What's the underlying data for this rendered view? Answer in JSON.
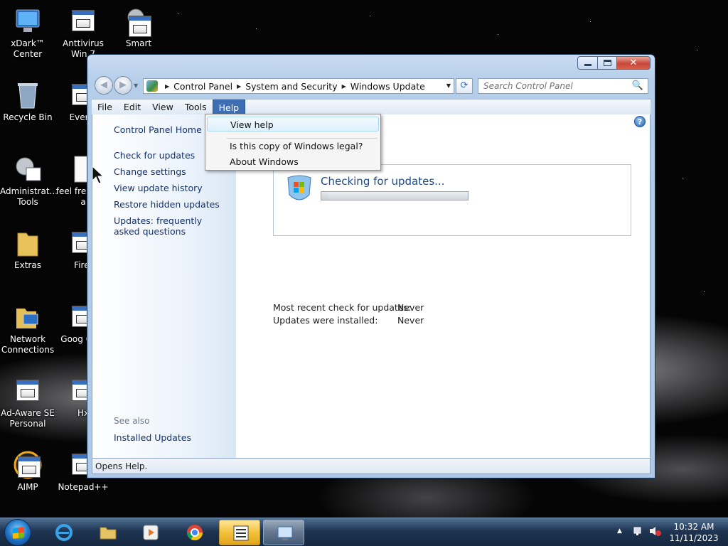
{
  "desktop": {
    "icons": [
      {
        "label": "xDark™ Center"
      },
      {
        "label": "Anttivirus Win 7"
      },
      {
        "label": "Smart"
      },
      {
        "label": "Recycle Bin"
      },
      {
        "label": "Everyt"
      },
      {
        "label": "Administrat... Tools"
      },
      {
        "label": "feel fre write a"
      },
      {
        "label": "Extras"
      },
      {
        "label": "Firef"
      },
      {
        "label": "Network Connections"
      },
      {
        "label": "Goog Chro"
      },
      {
        "label": "Ad-Aware SE Personal"
      },
      {
        "label": "Hx"
      },
      {
        "label": "AIMP"
      },
      {
        "label": "Notepad++"
      }
    ]
  },
  "window": {
    "caption": {
      "minimize": "minimize",
      "maximize": "maximize",
      "close": "✕"
    },
    "nav": {
      "back": "◀",
      "forward": "▶"
    },
    "address": {
      "crumbs": [
        "Control Panel",
        "System and Security",
        "Windows Update"
      ],
      "separator": "▶",
      "dropdown": "▼"
    },
    "refresh": "⟳",
    "search": {
      "placeholder": "Search Control Panel",
      "icon": "🔍"
    },
    "menubar": [
      {
        "label": "File"
      },
      {
        "label": "Edit"
      },
      {
        "label": "View"
      },
      {
        "label": "Tools"
      },
      {
        "label": "Help"
      }
    ],
    "help_menu": {
      "items": [
        {
          "label": "View help"
        },
        {
          "label": "Is this copy of Windows legal?"
        },
        {
          "label": "About Windows"
        }
      ]
    },
    "left_pane": {
      "home": "Control Panel Home",
      "links": [
        "Check for updates",
        "Change settings",
        "View update history",
        "Restore hidden updates",
        "Updates: frequently asked questions"
      ],
      "see_also_heading": "See also",
      "see_also": [
        "Installed Updates"
      ]
    },
    "help_icon": "?",
    "main": {
      "status_title": "Checking for updates...",
      "progress": 0.05,
      "info": [
        {
          "label": "Most recent check for updates:",
          "value": "Never"
        },
        {
          "label": "Updates were installed:",
          "value": "Never"
        }
      ]
    },
    "statusbar": "Opens Help."
  },
  "taskbar": {
    "clock_time": "10:32 AM",
    "clock_date": "11/11/2023",
    "tray_arrow": "▲"
  },
  "colors": {
    "accent": "#3e6fb4",
    "link": "#14306e",
    "title": "#1e4c8c"
  }
}
